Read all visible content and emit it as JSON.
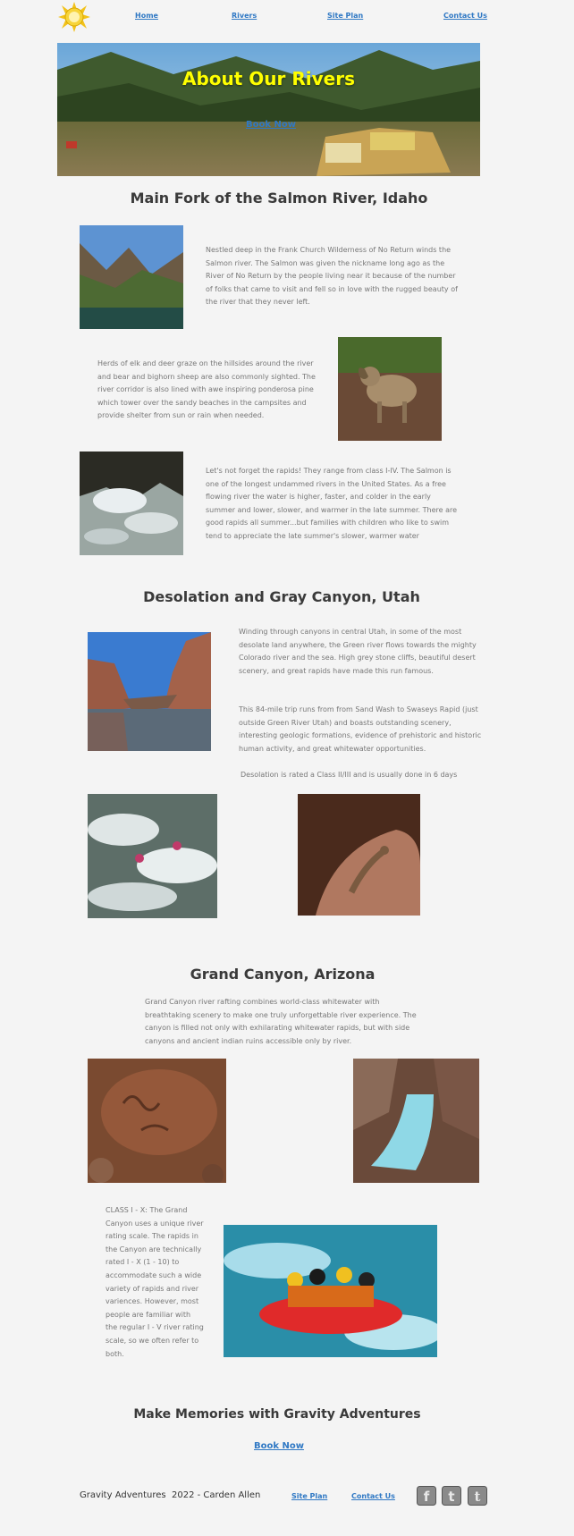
{
  "nav": {
    "home": "Home",
    "rivers": "Rivers",
    "site_plan": "Site Plan",
    "contact": "Contact Us"
  },
  "hero": {
    "title": "About Our Rivers",
    "book_now": "Book Now",
    "title_color": "#ffff00"
  },
  "salmon": {
    "heading": "Main Fork of the Salmon River, Idaho",
    "p1": "Nestled deep in the Frank Church Wilderness of No Return winds the Salmon river. The Salmon was given the nickname long ago as the River of No Return by the people living near it because of the number of folks that came to visit and fell so in love with the rugged beauty of the river that they never left.",
    "p2": "Herds of elk and deer graze on the hillsides around the river and bear and bighorn sheep are also commonly sighted. The river corridor is also lined with awe inspiring ponderosa pine which tower over the sandy beaches in the campsites and provide shelter from sun or rain when needed.",
    "p3": "Let's not forget the rapids! They range from class I-IV. The Salmon is one of the longest undammed rivers in the United States. As a free flowing river the water is higher, faster, and colder in the early summer and lower, slower, and warmer in the late summer. There are good rapids all summer...but families with children who like to swim tend to appreciate the late summer's slower, warmer water"
  },
  "desolation": {
    "heading": "Desolation and Gray Canyon, Utah",
    "p1": "Winding through canyons in central Utah, in some of the most desolate land anywhere, the Green river flows towards the mighty Colorado river and the sea. High grey stone cliffs, beautiful desert scenery, and great rapids have made this run famous.",
    "p2": "This 84-mile trip runs from from Sand Wash to Swaseys Rapid (just outside Green River Utah) and boasts outstanding scenery, interesting geologic formations, evidence of prehistoric and historic human activity, and great whitewater opportunities.",
    "p3": "Desolation is rated a Class II/III and is usually done in 6 days"
  },
  "grand": {
    "heading": "Grand Canyon, Arizona",
    "p1": "Grand Canyon river rafting combines world-class whitewater with breathtaking scenery to make one truly unforgettable river experience. The canyon is filled not only with exhilarating whitewater rapids, but with side canyons and ancient indian ruins accessible only by river.",
    "p2": "CLASS I - X: The Grand Canyon uses a unique river rating scale. The rapids in the Canyon are technically rated I - X (1 - 10) to accommodate such a wide variety of rapids and river variences. However, most people are familiar with the regular I - V river rating scale, so we often refer to both."
  },
  "cta": {
    "heading": "Make Memories with Gravity Adventures",
    "book_now": "Book Now"
  },
  "footer": {
    "copyright": "Gravity Adventures  2022 - Carden Allen",
    "site_plan": "Site Plan",
    "contact": "Contact Us",
    "social_icons": [
      "facebook-icon",
      "twitter-icon",
      "tumblr-icon"
    ]
  },
  "colors": {
    "link": "#2f78c4",
    "heading": "#3a3a3a",
    "body_text": "#777777",
    "background": "#f4f4f4"
  }
}
